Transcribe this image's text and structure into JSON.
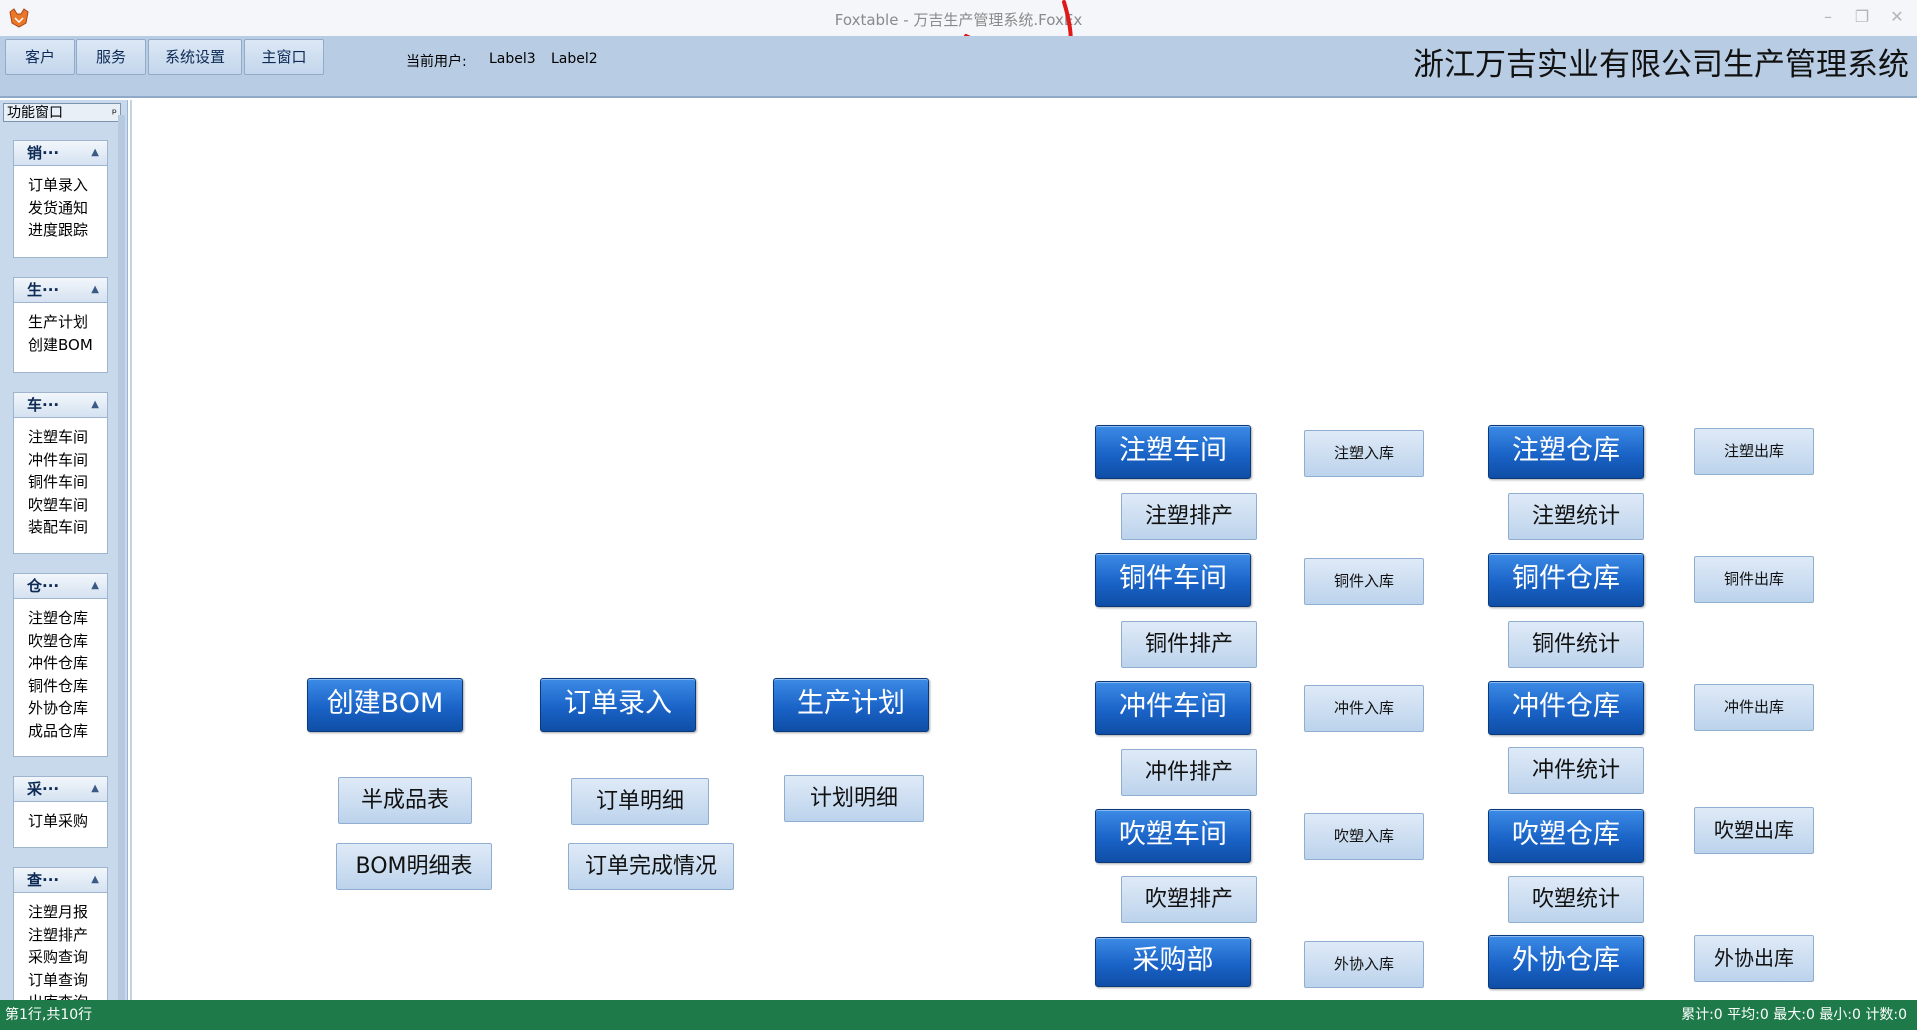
{
  "window": {
    "title": "Foxtable - 万吉生产管理系统.FoxEx",
    "minimize": "–",
    "restore": "❐",
    "close": "✕"
  },
  "toolbar": {
    "buttons": [
      "客户",
      "服务",
      "系统设置",
      "主窗口"
    ],
    "user_label": "当前用户:",
    "label3": "Label3",
    "label2": "Label2",
    "company": "浙江万吉实业有限公司生产管理系统"
  },
  "panel": {
    "title": "功能窗口",
    "pin": "ᵖ",
    "groups": [
      {
        "title": "销···",
        "items": [
          "订单录入",
          "发货通知",
          "进度跟踪"
        ]
      },
      {
        "title": "生···",
        "items": [
          "生产计划",
          "创建BOM"
        ]
      },
      {
        "title": "车···",
        "items": [
          "注塑车间",
          "冲件车间",
          "铜件车间",
          "吹塑车间",
          "装配车间"
        ]
      },
      {
        "title": "仓···",
        "items": [
          "注塑仓库",
          "吹塑仓库",
          "冲件仓库",
          "铜件仓库",
          "外协仓库",
          "成品仓库"
        ]
      },
      {
        "title": "采···",
        "items": [
          "订单采购"
        ]
      },
      {
        "title": "查···",
        "items": [
          "注塑月报",
          "注塑排产",
          "采购查询",
          "订单查询",
          "出库查询"
        ]
      }
    ]
  },
  "main": {
    "left_big": [
      "创建BOM",
      "订单录入",
      "生产计划"
    ],
    "left_small": [
      "半成品表",
      "订单明细",
      "计划明细",
      "BOM明细表",
      "订单完成情况"
    ],
    "workshops": [
      "注塑车间",
      "铜件车间",
      "冲件车间",
      "吹塑车间",
      "采购部"
    ],
    "schedules": [
      "注塑排产",
      "铜件排产",
      "冲件排产",
      "吹塑排产"
    ],
    "inbound": [
      "注塑入库",
      "铜件入库",
      "冲件入库",
      "吹塑入库",
      "外协入库"
    ],
    "warehouses": [
      "注塑仓库",
      "铜件仓库",
      "冲件仓库",
      "吹塑仓库",
      "外协仓库"
    ],
    "stats": [
      "注塑统计",
      "铜件统计",
      "冲件统计",
      "吹塑统计"
    ],
    "outbound": [
      "注塑出库",
      "铜件出库",
      "冲件出库",
      "吹塑出库",
      "外协出库"
    ]
  },
  "status": {
    "left": "第1行,共10行",
    "right": "累计:0 平均:0 最大:0 最小:0 计数:0"
  },
  "colors": {
    "toolbar": "#b8cde4",
    "primary_button": "#1a63c7",
    "status_bar": "#1e7a49"
  }
}
